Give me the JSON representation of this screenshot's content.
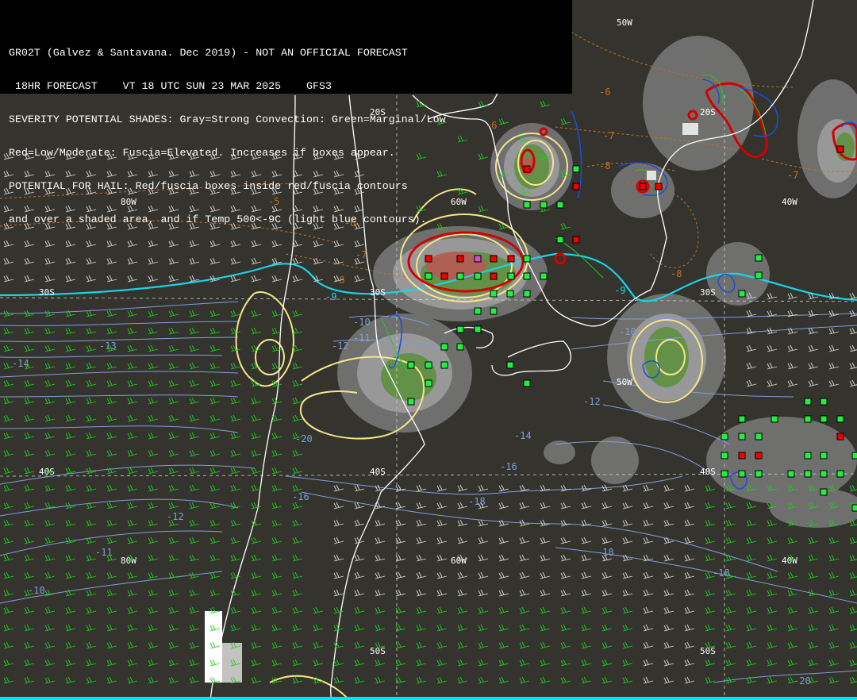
{
  "header": {
    "lines": [
      "GR02T (Galvez & Santavana. Dec 2019) - NOT AN OFFICIAL FORECAST",
      " 18HR FORECAST    VT 18 UTC SUN 23 MAR 2025    GFS3",
      "SEVERITY POTENTIAL SHADES: Gray=Strong Convection: Green=Marginal/Low",
      "Red=Low/Moderate: Fuscia=Elevated. Increases if boxes appear.",
      "POTENTIAL FOR HAIL: Red/fuscia boxes inside red/fuscia contours",
      "and over a shaded area, and if Temp 500<-9C (light blue contours)."
    ]
  },
  "grid_labels": {
    "lat_20s": "20S",
    "lat_30s": "30S",
    "lat_40s": "40S",
    "lat_50s": "50S",
    "lon_80w": "80W",
    "lon_60w": "60W",
    "lon_50w": "50W",
    "lon_40w": "40W"
  },
  "temp_labels": {
    "m5": "-5",
    "m6": "-6",
    "m7": "-7",
    "m8": "-8",
    "m9": "-9",
    "m10": "-10",
    "m11": "-11",
    "m12": "-12",
    "m13": "-13",
    "m14": "-14",
    "m16": "-16",
    "m18": "-18",
    "m20": "-20"
  },
  "colors": {
    "background": "#34332e",
    "gray_shade": "#7d7d7d",
    "gray_shade_light": "#a0a0a0",
    "green_shade": "#5a8a3c",
    "red_shade": "#b05050",
    "yellow_contour": "#f4e68a",
    "red_contour": "#d40000",
    "blue_contour": "#1b4fd8",
    "light_blue_temp": "#7f9fd9",
    "cyan_line": "#19d4e6",
    "orange_temp": "#c8701c",
    "wind_barb_green": "#22cc22",
    "wind_barb_white": "#d8d8d8",
    "box_green": "#22ee44",
    "box_red": "#ee0000"
  }
}
